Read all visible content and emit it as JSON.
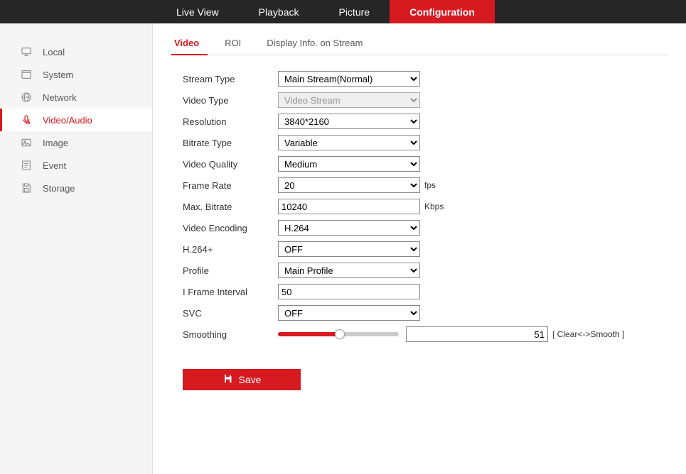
{
  "topnav": {
    "items": [
      {
        "label": "Live View"
      },
      {
        "label": "Playback"
      },
      {
        "label": "Picture"
      },
      {
        "label": "Configuration",
        "active": true
      }
    ]
  },
  "sidebar": {
    "items": [
      {
        "label": "Local",
        "icon": "monitor"
      },
      {
        "label": "System",
        "icon": "settings-window"
      },
      {
        "label": "Network",
        "icon": "globe"
      },
      {
        "label": "Video/Audio",
        "icon": "mic",
        "active": true
      },
      {
        "label": "Image",
        "icon": "image"
      },
      {
        "label": "Event",
        "icon": "file"
      },
      {
        "label": "Storage",
        "icon": "save-disk"
      }
    ]
  },
  "tabs": [
    {
      "label": "Video",
      "active": true
    },
    {
      "label": "ROI"
    },
    {
      "label": "Display Info. on Stream"
    }
  ],
  "form": {
    "stream_type": {
      "label": "Stream Type",
      "value": "Main Stream(Normal)"
    },
    "video_type": {
      "label": "Video Type",
      "value": "Video Stream",
      "disabled": true
    },
    "resolution": {
      "label": "Resolution",
      "value": "3840*2160"
    },
    "bitrate_type": {
      "label": "Bitrate Type",
      "value": "Variable"
    },
    "video_quality": {
      "label": "Video Quality",
      "value": "Medium"
    },
    "frame_rate": {
      "label": "Frame Rate",
      "value": "20",
      "suffix": "fps"
    },
    "max_bitrate": {
      "label": "Max. Bitrate",
      "value": "10240",
      "suffix": "Kbps"
    },
    "video_encoding": {
      "label": "Video Encoding",
      "value": "H.264"
    },
    "h264_plus": {
      "label": "H.264+",
      "value": "OFF"
    },
    "profile": {
      "label": "Profile",
      "value": "Main Profile"
    },
    "i_frame": {
      "label": "I Frame Interval",
      "value": "50"
    },
    "svc": {
      "label": "SVC",
      "value": "OFF"
    },
    "smoothing": {
      "label": "Smoothing",
      "value": "51",
      "hint": "[ Clear<->Smooth ]"
    }
  },
  "buttons": {
    "save": "Save"
  }
}
